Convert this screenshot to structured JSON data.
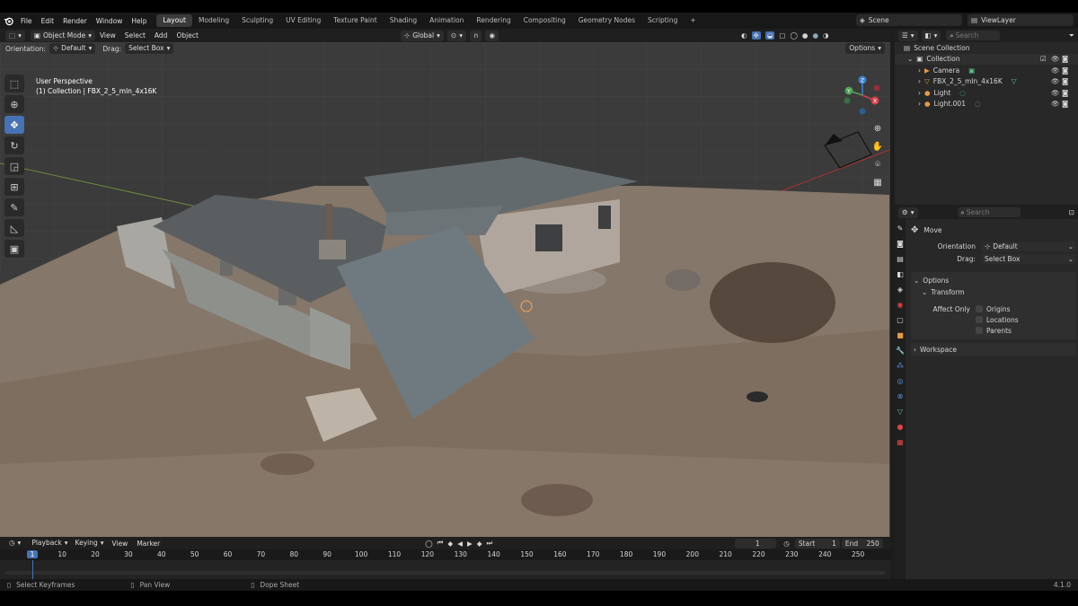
{
  "menu": {
    "file": "File",
    "edit": "Edit",
    "render": "Render",
    "window": "Window",
    "help": "Help"
  },
  "workspaces": [
    "Layout",
    "Modeling",
    "Sculpting",
    "UV Editing",
    "Texture Paint",
    "Shading",
    "Animation",
    "Rendering",
    "Compositing",
    "Geometry Nodes",
    "Scripting",
    "+"
  ],
  "scene": "Scene",
  "view_layer": "ViewLayer",
  "header": {
    "mode": "Object Mode",
    "view": "View",
    "select": "Select",
    "add": "Add",
    "object": "Object",
    "transform_orientation": "Global",
    "options": "Options"
  },
  "tool_settings": {
    "orientation_label": "Orientation:",
    "orientation_value": "Default",
    "drag_label": "Drag:",
    "drag_value": "Select Box"
  },
  "viewport": {
    "perspective": "User Perspective",
    "collection_info": "(1) Collection | FBX_2_5_mln_4x16K"
  },
  "outliner": {
    "search_placeholder": "Search",
    "root": "Scene Collection",
    "collection": "Collection",
    "items": [
      {
        "name": "Camera"
      },
      {
        "name": "FBX_2_5_mln_4x16K"
      },
      {
        "name": "Light"
      },
      {
        "name": "Light.001"
      }
    ]
  },
  "properties": {
    "search_placeholder": "Search",
    "tool": "Move",
    "orientation_label": "Orientation",
    "orientation_value": "Default",
    "drag_label": "Drag:",
    "drag_value": "Select Box",
    "options": "Options",
    "transform": "Transform",
    "affect_only": "Affect Only",
    "origins": "Origins",
    "locations": "Locations",
    "parents": "Parents",
    "workspace": "Workspace"
  },
  "timeline": {
    "playback": "Playback",
    "keying": "Keying",
    "view": "View",
    "marker": "Marker",
    "current_frame": "1",
    "start_label": "Start",
    "start": "1",
    "end_label": "End",
    "end": "250",
    "ticks": [
      "1",
      "10",
      "20",
      "30",
      "40",
      "50",
      "60",
      "70",
      "80",
      "90",
      "100",
      "110",
      "120",
      "130",
      "140",
      "150",
      "160",
      "170",
      "180",
      "190",
      "200",
      "210",
      "220",
      "230",
      "240",
      "250"
    ]
  },
  "status": {
    "select": "Select Keyframes",
    "pan": "Pan View",
    "dope": "Dope Sheet",
    "version": "4.1.0"
  },
  "colors": {
    "accent": "#4772b3",
    "active_frame": "#4772b3"
  }
}
